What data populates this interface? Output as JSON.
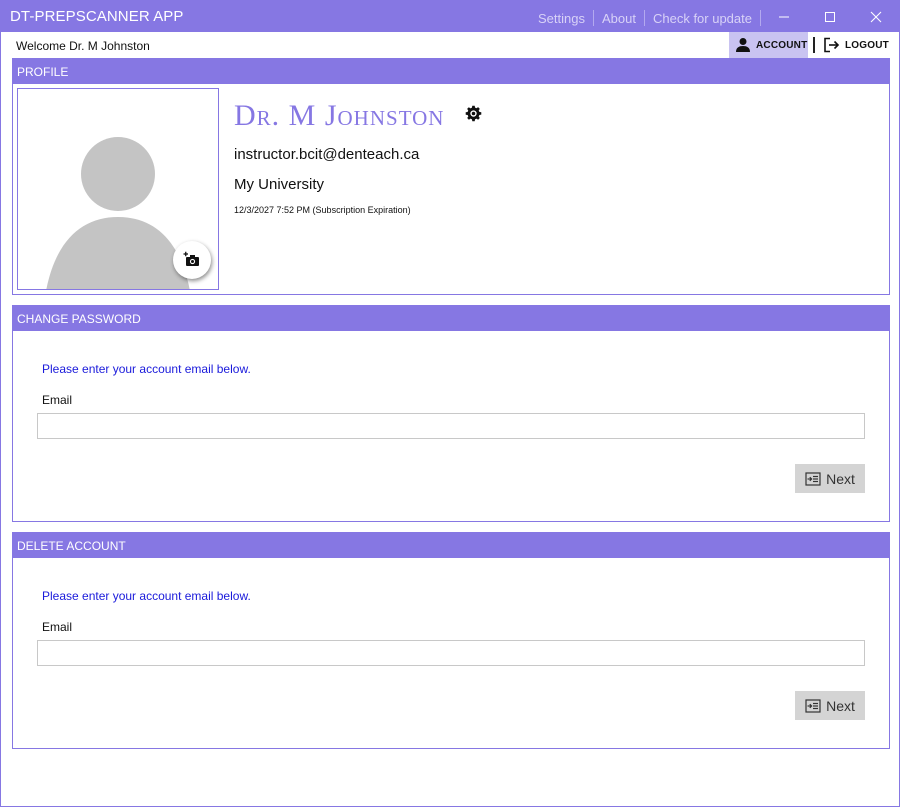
{
  "app": {
    "title": "DT-PREPSCANNER APP",
    "menu": [
      "Settings",
      "About",
      "Check for update"
    ],
    "accent_color": "#8677e3"
  },
  "window_controls": {
    "minimize_icon": "minimize-icon",
    "maximize_icon": "maximize-icon",
    "close_icon": "close-icon"
  },
  "nav": {
    "welcome": "Welcome Dr. M Johnston",
    "account_label": "ACCOUNT",
    "logout_label": "LOGOUT"
  },
  "profile": {
    "header": "PROFILE",
    "name": "Dr. M Johnston",
    "email": "instructor.bcit@denteach.ca",
    "organization": "My University",
    "expiration": "12/3/2027 7:52 PM (Subscription Expiration)"
  },
  "change_password": {
    "header": "CHANGE PASSWORD",
    "hint": "Please enter your account email below.",
    "email_label": "Email",
    "email_value": "",
    "next_label": "Next"
  },
  "delete_account": {
    "header": "DELETE ACCOUNT",
    "hint": "Please enter your account email below.",
    "email_label": "Email",
    "email_value": "",
    "next_label": "Next"
  }
}
